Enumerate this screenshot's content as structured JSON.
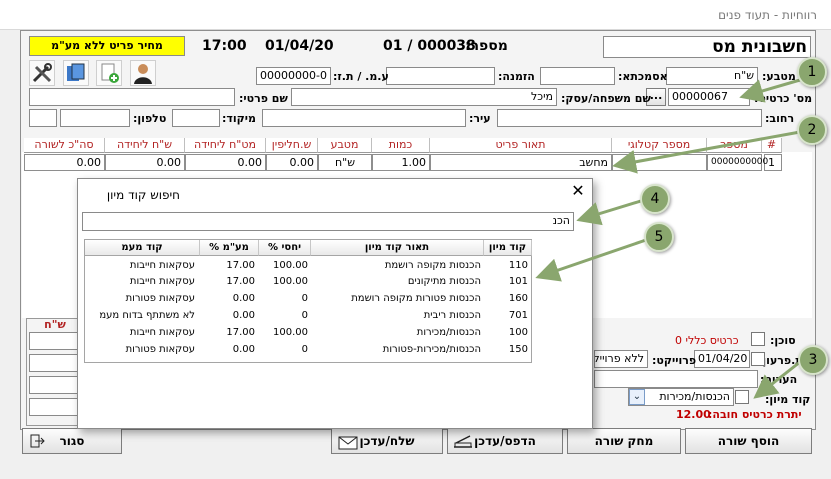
{
  "window": {
    "title": "רווחיות - תעוד פנים"
  },
  "header": {
    "doc_type": "חשבונית מס",
    "number_label": "מספר:",
    "number_value": "01 / 000038",
    "date": "01/04/20",
    "time": "17:00",
    "price_mode": "מחיר פריט ללא מע\"מ"
  },
  "form": {
    "currency_label": "מטבע:",
    "currency_value": "ש\"ח",
    "reference_label": "אסמכתא:",
    "order_label": "הזמנה:",
    "taxid_label": "ע.מ. / ת.ז:",
    "taxid_value": "00000000-0",
    "card_label": "מס' כרטיס:",
    "card_value": "00000067",
    "card_lookup": "...",
    "lastname_label": "שם משפחה/עסק:",
    "lastname_value": "מיכל",
    "firstname_label": "שם פרטי:",
    "street_label": "רחוב:",
    "city_label": "עיר:",
    "zip_label": "מיקוד:",
    "phone_label": "טלפון:"
  },
  "table": {
    "headers": [
      "#",
      "מספר",
      "מספר קטלוגי",
      "תאור פריט",
      "כמות",
      "מטבע",
      "ש.חליפין",
      "מט\"ח ליחידה",
      "ש\"ח ליחידה",
      "סה\"כ לשורה"
    ],
    "row": {
      "num": "1",
      "number": "0000000000",
      "catalog": "",
      "desc": "מחשב",
      "qty": "1.00",
      "currency": "ש\"ח",
      "rate": "0.00",
      "fx_unit": "0.00",
      "ils_unit": "0.00",
      "total": "0.00"
    }
  },
  "bottom": {
    "agent_label": "סוכן:",
    "agent_value": "כרטיס כללי 0",
    "due_label": "ת.פרעון:",
    "due_date": "01/04/20",
    "project_label": "פרוייקט:",
    "project_value": "ללא פרוייקט",
    "notes_label": "הערות:",
    "classification_label": "קוד מיון:",
    "classification_value": "הכנסות/מכירות",
    "balance_label": "יתרת כרטיס חובה:",
    "balance_value": "12.00",
    "totals_header": "ש\"ח"
  },
  "buttons": {
    "add_row": "הוסף שורה",
    "delete_row": "מחק שורה",
    "print": "הדפס/עדכן",
    "send": "שלח/עדכן",
    "close": "סגור"
  },
  "dialog": {
    "title": "חיפוש קוד מיון",
    "search_value": "הכנ",
    "headers": [
      "קוד מיון",
      "תאור קוד מיון",
      "% יחסי",
      "% מע\"מ",
      "קוד מעמ"
    ],
    "rows": [
      [
        "110",
        "הכנסות מקופה רושמת",
        "100.00",
        "17.00",
        "עסקאות חייבות"
      ],
      [
        "101",
        "הכנסות מתיקונים",
        "100.00",
        "17.00",
        "עסקאות חייבות"
      ],
      [
        "160",
        "הכנסות פטורות מקופה רושמת",
        "0",
        "0.00",
        "עסקאות פטורות"
      ],
      [
        "701",
        "הכנסות ריבית",
        "0",
        "0.00",
        "לא משתתף בדוח מעמ"
      ],
      [
        "100",
        "הכנסות/מכירות",
        "100.00",
        "17.00",
        "עסקאות חייבות"
      ],
      [
        "150",
        "הכנסות/מכירות-פטורות",
        "0",
        "0.00",
        "עסקאות פטורות"
      ]
    ]
  },
  "callouts": [
    "1",
    "2",
    "3",
    "4",
    "5"
  ],
  "colors": {
    "yellow": "#ffff00",
    "green": "#8aa66e",
    "red": "#c00000",
    "header_red": "#b22222"
  }
}
